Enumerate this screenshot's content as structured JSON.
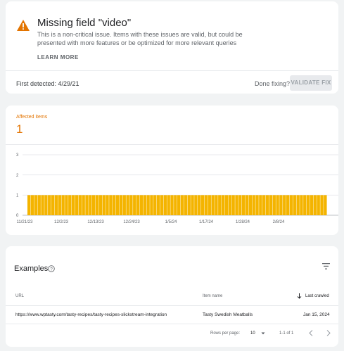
{
  "issue": {
    "title": "Missing field \"video\"",
    "description": "This is a non-critical issue. Items with these issues are valid, but could be presented with more features or be optimized for more relevant queries",
    "learn_more": "LEARN MORE",
    "first_detected": "First detected: 4/29/21",
    "done_fixing": "Done fixing?",
    "validate_fix": "VALIDATE FIX",
    "warning_color": "#e37400"
  },
  "affected": {
    "label": "Affected items",
    "count": "1"
  },
  "chart_data": {
    "type": "bar",
    "ylim": [
      0,
      3
    ],
    "yticks": [
      "0",
      "1",
      "2",
      "3"
    ],
    "xticks": [
      "11/21/23",
      "12/2/23",
      "12/13/23",
      "12/24/23",
      "1/5/24",
      "1/17/24",
      "1/28/24",
      "2/8/24"
    ],
    "bar_count": 88,
    "values_all": 1,
    "bar_color": "#f4b400",
    "grid": true
  },
  "examples": {
    "title": "Examples",
    "columns": {
      "url": "URL",
      "item_name": "Item name",
      "last_crawled": "Last crawled"
    },
    "rows": [
      {
        "url": "https://www.wptasty.com/tasty-recipes/tasty-recipes-slickstream-integration",
        "item_name": "Tasty Swedish Meatballs",
        "last_crawled": "Jan 15, 2024"
      }
    ],
    "pagination": {
      "rows_per_page_label": "Rows per page:",
      "rows_per_page": "10",
      "range": "1-1 of 1"
    }
  }
}
